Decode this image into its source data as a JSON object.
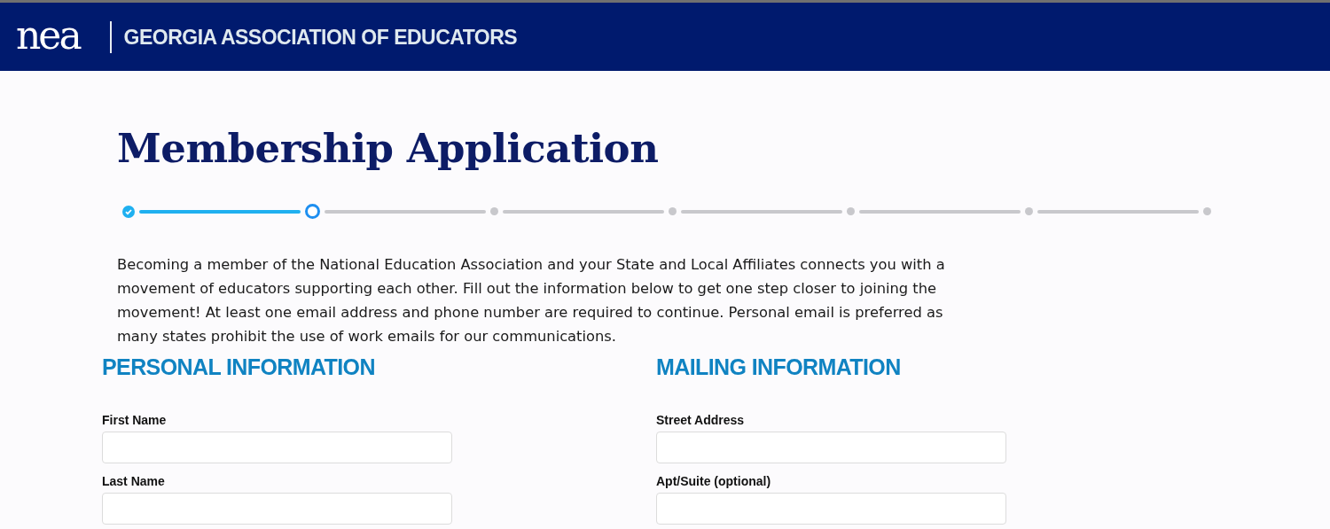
{
  "header": {
    "logo": "nea",
    "organization": "GEORGIA ASSOCIATION OF EDUCATORS"
  },
  "title": "Membership Application",
  "steps": [
    {
      "completed": true,
      "current": false
    },
    {
      "completed": false,
      "current": true
    },
    {
      "completed": false,
      "current": false
    },
    {
      "completed": false,
      "current": false
    },
    {
      "completed": false,
      "current": false
    },
    {
      "completed": false,
      "current": false
    },
    {
      "completed": false,
      "current": false
    }
  ],
  "intro": "Becoming a member of the National Education Association and your State and Local Affiliates connects you with a movement of educators supporting each other. Fill out the information below to get one step closer to joining the movement! At least one email address and phone number are required to continue. Personal email is preferred as many states prohibit the use of work emails for our communications.",
  "sections": [
    {
      "heading": "PERSONAL INFORMATION",
      "fields": [
        {
          "label": "First Name"
        },
        {
          "label": "Last Name"
        }
      ]
    },
    {
      "heading": "MAILING INFORMATION",
      "fields": [
        {
          "label": "Street Address"
        },
        {
          "label": "Apt/Suite (optional)"
        }
      ]
    }
  ]
}
